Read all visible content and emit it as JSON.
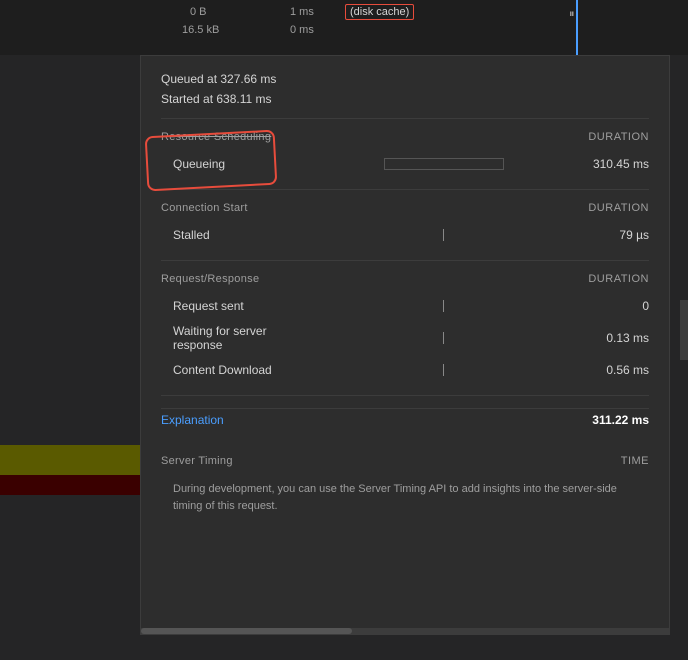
{
  "background": {
    "color": "#252526"
  },
  "timeline": {
    "label_0b": "0 B",
    "label_1ms": "1 ms",
    "label_disk_cache": "(disk cache)",
    "label_16kb": "16.5 kB",
    "label_0ms_sub": "0 ms"
  },
  "popup": {
    "queued_label": "Queued at 327.66 ms",
    "started_label": "Started at 638.11 ms",
    "sections": [
      {
        "title": "Resource Scheduling",
        "duration_col": "DURATION",
        "rows": [
          {
            "label": "Queueing",
            "bar_type": "empty",
            "value": "310.45 ms"
          }
        ]
      },
      {
        "title": "Connection Start",
        "duration_col": "DURATION",
        "rows": [
          {
            "label": "Stalled",
            "bar_type": "tick",
            "value": "79 µs"
          }
        ]
      },
      {
        "title": "Request/Response",
        "duration_col": "DURATION",
        "rows": [
          {
            "label": "Request sent",
            "bar_type": "tick",
            "value": "0"
          },
          {
            "label": "Waiting for server response",
            "bar_type": "tick",
            "value": "0.13 ms"
          },
          {
            "label": "Content Download",
            "bar_type": "tick",
            "value": "0.56 ms"
          }
        ]
      }
    ],
    "explanation_link": "Explanation",
    "total_value": "311.22 ms",
    "server_timing": {
      "title": "Server Timing",
      "time_col": "TIME",
      "description": "During development, you can use the Server Timing API to add insights into the server-side timing of this request."
    }
  }
}
